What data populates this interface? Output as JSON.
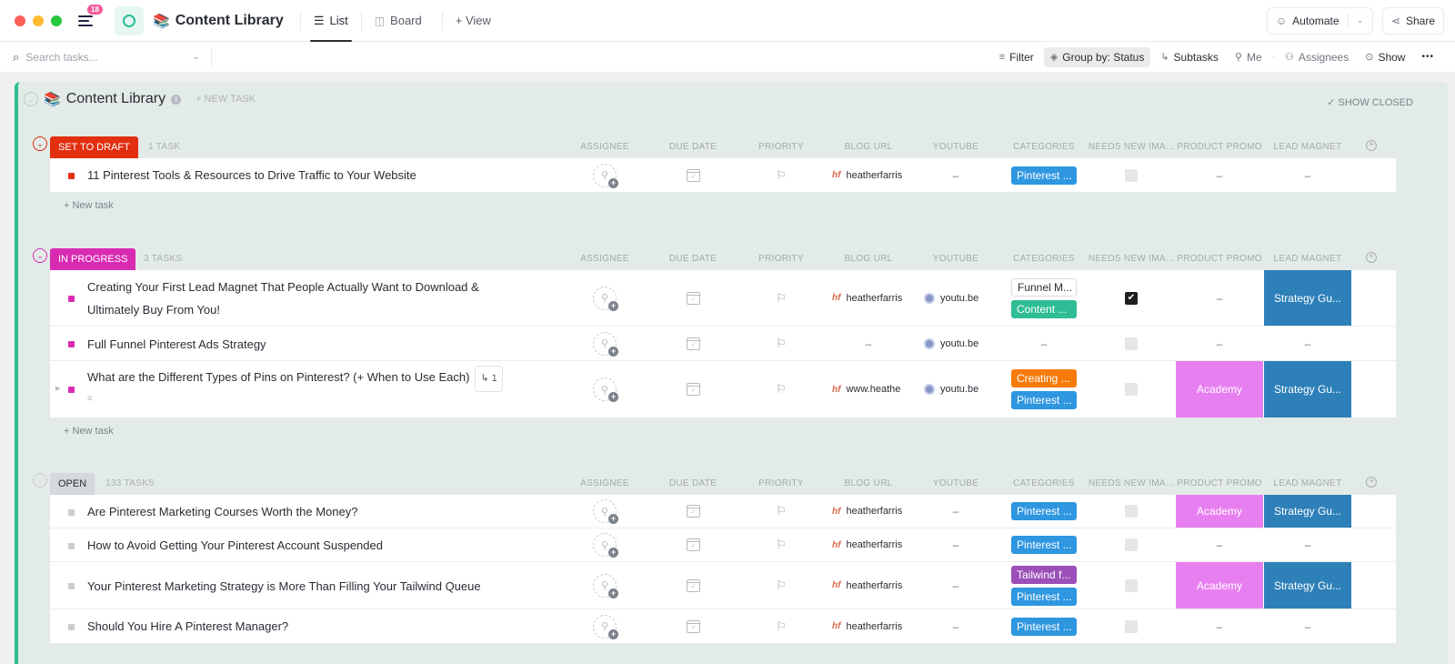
{
  "window": {
    "traffic_lights": [
      "#fe5f57",
      "#febc2e",
      "#28c840"
    ],
    "notifications_badge": "18",
    "title": "Content Library",
    "title_icon": "books-emoji"
  },
  "tabs": [
    {
      "label": "List",
      "icon": "list-icon",
      "active": true
    },
    {
      "label": "Board",
      "icon": "board-icon",
      "active": false
    },
    {
      "label": "+ View",
      "icon": "",
      "active": false
    }
  ],
  "header_actions": {
    "automate_label": "Automate",
    "share_label": "Share"
  },
  "toolbar": {
    "search_placeholder": "Search tasks...",
    "filter_label": "Filter",
    "group_by_label": "Group by: Status",
    "subtasks_label": "Subtasks",
    "me_label": "Me",
    "assignees_label": "Assignees",
    "show_label": "Show",
    "more_label": "•••"
  },
  "list": {
    "title": "Content Library",
    "new_task_label": "+ NEW TASK",
    "show_closed_label": "✓ SHOW CLOSED",
    "accent": "#2ebd94"
  },
  "columns": [
    "ASSIGNEE",
    "DUE DATE",
    "PRIORITY",
    "BLOG URL",
    "YOUTUBE",
    "CATEGORIES",
    "NEEDS NEW IMA...",
    "PRODUCT PROMO",
    "LEAD MAGNET"
  ],
  "new_task_row_label": "+ New task",
  "groups": [
    {
      "status": "SET TO DRAFT",
      "color": "#e22f10",
      "count": "1 TASK",
      "tasks": [
        {
          "name": "11 Pinterest Tools & Resources to Drive Traffic to Your Website",
          "blog_url": "heatherfarris",
          "youtube": "–",
          "categories": [
            {
              "label": "Pinterest ...",
              "color": "#2f96e0"
            }
          ],
          "needs_new_image": false,
          "product_promo": "–",
          "lead_magnet": "–"
        }
      ]
    },
    {
      "status": "IN PROGRESS",
      "color": "#d82bb2",
      "count": "3 TASKS",
      "tasks": [
        {
          "name": "Creating Your First Lead Magnet That People Actually Want to Download & Ultimately Buy From You!",
          "blog_url": "heatherfarris",
          "youtube": "youtu.be",
          "categories": [
            {
              "label": "Funnel M...",
              "color": "outline"
            },
            {
              "label": "Content ...",
              "color": "#2ebd94"
            }
          ],
          "needs_new_image": true,
          "product_promo": "–",
          "lead_magnet": "Strategy Gu..."
        },
        {
          "name": "Full Funnel Pinterest Ads Strategy",
          "blog_url": "–",
          "youtube": "youtu.be",
          "categories": [],
          "needs_new_image": false,
          "product_promo": "–",
          "lead_magnet": "–"
        },
        {
          "name": "What are the Different Types of Pins on Pinterest? (+ When to Use Each)",
          "subtask_count": "1",
          "blog_url": "www.heathe",
          "youtube": "youtu.be",
          "categories": [
            {
              "label": "Creating ...",
              "color": "#f77b0b"
            },
            {
              "label": "Pinterest ...",
              "color": "#2f96e0"
            }
          ],
          "needs_new_image": false,
          "product_promo": "Academy",
          "lead_magnet": "Strategy Gu..."
        }
      ]
    },
    {
      "status": "OPEN",
      "color": "#d5d8dc",
      "count": "133 TASKS",
      "tasks": [
        {
          "name": "Are Pinterest Marketing Courses Worth the Money?",
          "blog_url": "heatherfarris",
          "youtube": "–",
          "categories": [
            {
              "label": "Pinterest ...",
              "color": "#2f96e0"
            }
          ],
          "needs_new_image": false,
          "product_promo": "Academy",
          "lead_magnet": "Strategy Gu..."
        },
        {
          "name": "How to Avoid Getting Your Pinterest Account Suspended",
          "blog_url": "heatherfarris",
          "youtube": "–",
          "categories": [
            {
              "label": "Pinterest ...",
              "color": "#2f96e0"
            }
          ],
          "needs_new_image": false,
          "product_promo": "–",
          "lead_magnet": "–"
        },
        {
          "name": "Your Pinterest Marketing Strategy is More Than Filling Your Tailwind Queue",
          "blog_url": "heatherfarris",
          "youtube": "–",
          "categories": [
            {
              "label": "Tailwind f...",
              "color": "#9b4fb8"
            },
            {
              "label": "Pinterest ...",
              "color": "#2f96e0"
            }
          ],
          "needs_new_image": false,
          "product_promo": "Academy",
          "lead_magnet": "Strategy Gu..."
        },
        {
          "name": "Should You Hire A Pinterest Manager?",
          "blog_url": "heatherfarris",
          "youtube": "–",
          "categories": [
            {
              "label": "Pinterest ...",
              "color": "#2f96e0"
            }
          ],
          "needs_new_image": false,
          "product_promo": "–",
          "lead_magnet": "–"
        }
      ]
    }
  ],
  "colors": {
    "academy": "#e87ff0",
    "strategy_guide": "#2e80b9"
  }
}
